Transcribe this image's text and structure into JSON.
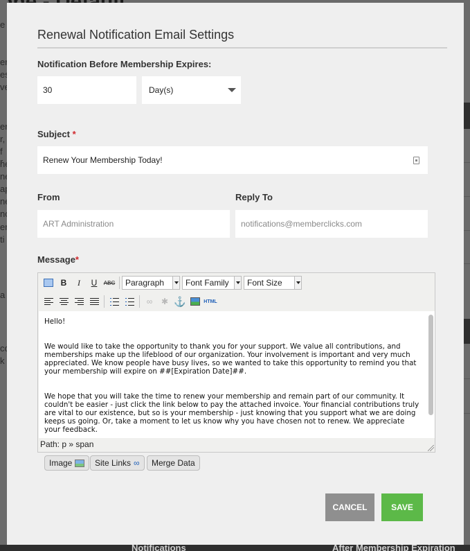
{
  "background": {
    "title": "one - Default",
    "left_fragments": [
      "e",
      "er",
      "es",
      "ve",
      "er",
      "r,",
      "f r",
      "ne",
      "ne",
      "ap",
      "ne",
      "nc",
      "er",
      "ti",
      "a",
      "co",
      "k"
    ],
    "right_fragments": [
      "o",
      "ge",
      "ot",
      "e"
    ],
    "bottom_left": "Notifications",
    "bottom_right": "After Membership Expiration"
  },
  "modal": {
    "title": "Renewal Notification Email Settings",
    "notification_label": "Notification Before Membership Expires:",
    "notification_value": "30",
    "unit_selected": "Day(s)",
    "subject_label": "Subject",
    "required_mark": "*",
    "subject_value": "Renew Your Membership Today!",
    "from_label": "From",
    "from_placeholder": "ART Administration",
    "reply_label": "Reply To",
    "reply_placeholder": "notifications@memberclicks.com",
    "message_label": "Message",
    "toolbar": {
      "bold": "B",
      "italic": "I",
      "underline": "U",
      "strike": "ABC",
      "format": "Paragraph",
      "font_family": "Font Family",
      "font_size": "Font Size",
      "html": "HTML"
    },
    "editor": {
      "greeting": "Hello!",
      "para1": "We would like to take the opportunity to thank you for your support. We value all contributions, and memberships make up the lifeblood of our organization. Your involvement is important and very much appreciated. We know people have busy lives, so we wanted to take this opportunity to remind you that your membership will expire on ##[Expiration Date]##.",
      "para2": "We hope that you will take the time to renew your membership and remain part of our community. It couldn't be easier - just click the link below to pay the attached invoice. Your financial contributions truly are vital to our existence, but so is your membership - just knowing that you support what we are doing keeps us going.  Or, take a moment to let us know why you have chosen not to renew. We appreciate your feedback.",
      "path": "Path: p » span"
    },
    "insert_buttons": {
      "image": "Image",
      "site_links": "Site Links",
      "merge_data": "Merge Data"
    },
    "cancel": "CANCEL",
    "save": "SAVE"
  },
  "colors": {
    "save": "#5cb948",
    "cancel": "#8f8f8f",
    "required": "#d0282d",
    "modal_bg": "#efefef"
  }
}
